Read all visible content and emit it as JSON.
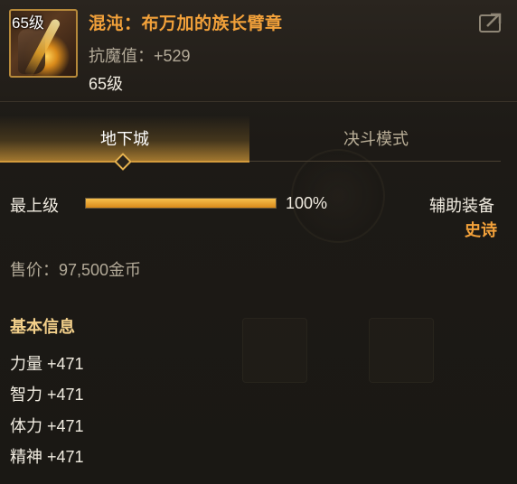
{
  "item": {
    "icon_name": "armband-item-icon",
    "level_badge": "65级",
    "name": "混沌：布万加的族长臂章",
    "magic_resist": "抗魔值：+529",
    "level": "65级",
    "share_icon": "share-icon"
  },
  "tabs": [
    {
      "label": "地下城",
      "active": true
    },
    {
      "label": "决斗模式",
      "active": false
    }
  ],
  "level_row": {
    "label": "最上级",
    "progress_percent": 100,
    "percent_text": "100%",
    "slot_type": "辅助装备",
    "rarity": "史诗"
  },
  "price": "售价：97,500金币",
  "basic_info": {
    "title": "基本信息",
    "stats": [
      "力量 +471",
      "智力 +471",
      "体力 +471",
      "精神 +471"
    ]
  },
  "colors": {
    "accent_orange": "#f2a13a",
    "tab_gold": "#d49b3c",
    "section_gold": "#f2cf8a",
    "muted_text": "#b3aa98"
  }
}
